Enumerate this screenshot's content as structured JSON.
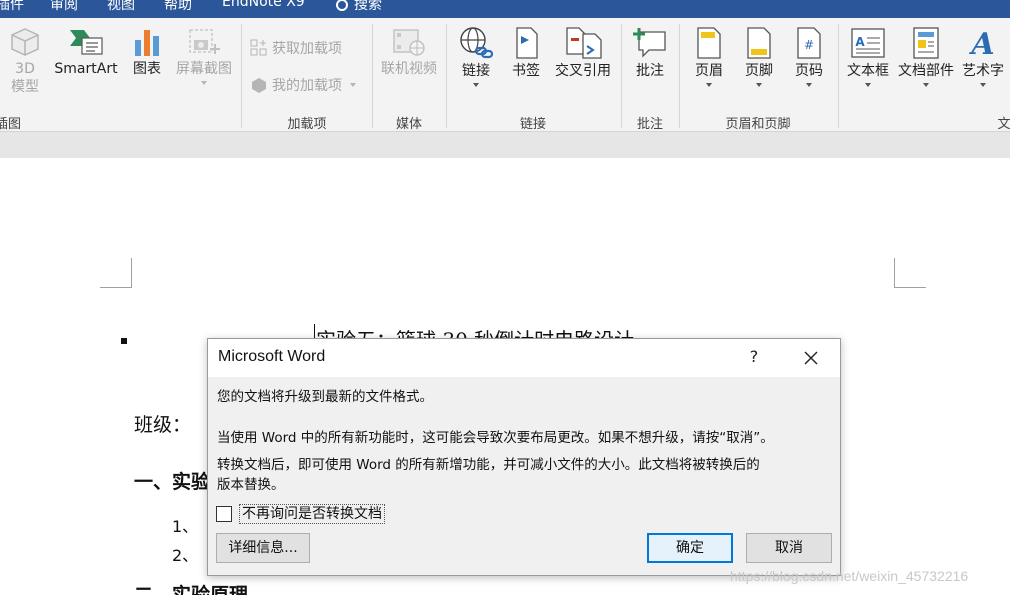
{
  "menu": {
    "items": [
      "插件",
      "审阅",
      "视图",
      "帮助",
      "EndNote X9"
    ],
    "search_label": "搜索"
  },
  "ribbon": {
    "illustrations": {
      "model3d_line1": "3D",
      "model3d_line2": "模型",
      "smartart": "SmartArt",
      "chart": "图表",
      "screenshot": "屏幕截图",
      "group_label": "插图"
    },
    "addins": {
      "get_addins": "获取加载项",
      "my_addins": "我的加载项",
      "group_label": "加载项"
    },
    "media": {
      "online_video": "联机视频",
      "group_label": "媒体"
    },
    "links": {
      "link": "链接",
      "bookmark": "书签",
      "cross_ref": "交叉引用",
      "group_label": "链接"
    },
    "comments": {
      "comment": "批注",
      "group_label": "批注"
    },
    "header_footer": {
      "header": "页眉",
      "footer": "页脚",
      "page_number": "页码",
      "group_label": "页眉和页脚"
    },
    "text": {
      "textbox": "文本框",
      "doc_parts": "文档部件",
      "wordart": "艺术字",
      "group_label_partial": "文"
    }
  },
  "document": {
    "title": "实验五：篮球 30 秒倒计时电路设计",
    "class_label": "班级：",
    "section1": "一、实验",
    "item1": "1、",
    "item2": "2、",
    "section2": "二、实验原理"
  },
  "dialog": {
    "title": "Microsoft Word",
    "help_symbol": "?",
    "message1": "您的文档将升级到最新的文件格式。",
    "message2": "当使用 Word 中的所有新功能时，这可能会导致次要布局更改。如果不想升级，请按“取消”。",
    "message3_line1": "转换文档后，即可使用 Word 的所有新增功能，并可减小文件的大小。此文档将被转换后的",
    "message3_line2": "版本替换。",
    "checkbox_label": "不再询问是否转换文档",
    "checkbox_checked": false,
    "details_button": "详细信息...",
    "ok_button": "确定",
    "cancel_button": "取消"
  },
  "watermark": "https://blog.csdn.net/weixin_45732216",
  "colors": {
    "title_bar": "#2b579a",
    "ribbon_bg": "#f3f3f3",
    "accent_blue": "#0078d7"
  }
}
